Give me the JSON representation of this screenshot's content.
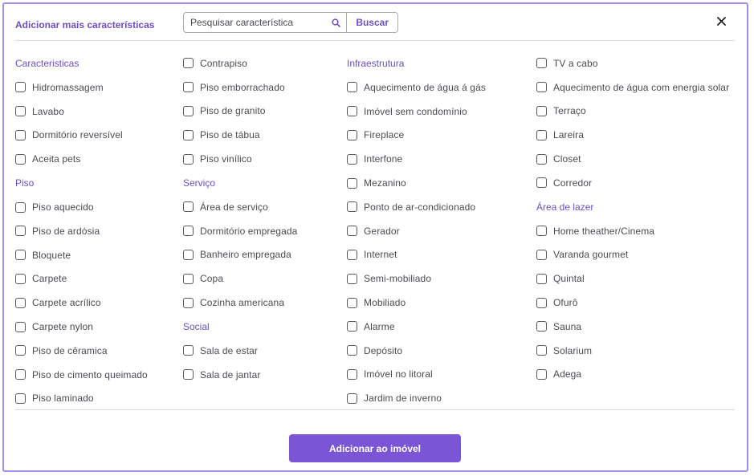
{
  "header": {
    "title": "Adicionar mais características",
    "search_placeholder": "Pesquisar característica",
    "search_button": "Buscar",
    "close_symbol": "✕"
  },
  "icons": {
    "search": "search-icon",
    "close": "close-icon"
  },
  "colors": {
    "accent": "#7a56d6",
    "heading": "#6d4ec4",
    "frame": "#a38bea"
  },
  "columns": [
    [
      {
        "type": "heading",
        "label": "Caracteristicas"
      },
      {
        "type": "option",
        "label": "Hidromassagem"
      },
      {
        "type": "option",
        "label": "Lavabo"
      },
      {
        "type": "option",
        "label": "Dormitório reversível"
      },
      {
        "type": "option",
        "label": "Aceita pets"
      },
      {
        "type": "heading",
        "label": "Piso"
      },
      {
        "type": "option",
        "label": "Piso aquecido"
      },
      {
        "type": "option",
        "label": "Piso de ardósia"
      },
      {
        "type": "option",
        "label": "Bloquete"
      },
      {
        "type": "option",
        "label": "Carpete"
      },
      {
        "type": "option",
        "label": "Carpete acrílico"
      },
      {
        "type": "option",
        "label": "Carpete nylon"
      },
      {
        "type": "option",
        "label": "Piso de cêramica"
      },
      {
        "type": "option",
        "label": "Piso de cimento queimado"
      },
      {
        "type": "option",
        "label": "Piso laminado"
      }
    ],
    [
      {
        "type": "option",
        "label": "Contrapiso"
      },
      {
        "type": "option",
        "label": "Piso emborrachado"
      },
      {
        "type": "option",
        "label": "Piso de granito"
      },
      {
        "type": "option",
        "label": "Piso de tábua"
      },
      {
        "type": "option",
        "label": "Piso vinílico"
      },
      {
        "type": "heading",
        "label": "Serviço"
      },
      {
        "type": "option",
        "label": "Área de serviço"
      },
      {
        "type": "option",
        "label": "Dormitório empregada"
      },
      {
        "type": "option",
        "label": "Banheiro empregada"
      },
      {
        "type": "option",
        "label": "Copa"
      },
      {
        "type": "option",
        "label": "Cozinha  americana"
      },
      {
        "type": "heading",
        "label": "Social"
      },
      {
        "type": "option",
        "label": "Sala de estar"
      },
      {
        "type": "option",
        "label": "Sala de jantar"
      }
    ],
    [
      {
        "type": "heading",
        "label": "Infraestrutura"
      },
      {
        "type": "option",
        "label": "Aquecimento de água á gás"
      },
      {
        "type": "option",
        "label": "Imóvel sem condomínio"
      },
      {
        "type": "option",
        "label": "Fireplace"
      },
      {
        "type": "option",
        "label": "Interfone"
      },
      {
        "type": "option",
        "label": "Mezanino"
      },
      {
        "type": "option",
        "label": "Ponto de ar-condicionado"
      },
      {
        "type": "option",
        "label": "Gerador"
      },
      {
        "type": "option",
        "label": "Internet"
      },
      {
        "type": "option",
        "label": "Semi-mobiliado"
      },
      {
        "type": "option",
        "label": "Mobiliado"
      },
      {
        "type": "option",
        "label": "Alarme"
      },
      {
        "type": "option",
        "label": "Depósito"
      },
      {
        "type": "option",
        "label": "Imóvel no litoral"
      },
      {
        "type": "option",
        "label": "Jardim de inverno"
      }
    ],
    [
      {
        "type": "option",
        "label": "TV a cabo"
      },
      {
        "type": "option",
        "label": "Aquecimento de água com energia solar"
      },
      {
        "type": "option",
        "label": "Terraço"
      },
      {
        "type": "option",
        "label": "Lareira"
      },
      {
        "type": "option",
        "label": "Closet"
      },
      {
        "type": "option",
        "label": "Corredor"
      },
      {
        "type": "heading",
        "label": "Área de lazer"
      },
      {
        "type": "option",
        "label": "Home theather/Cinema"
      },
      {
        "type": "option",
        "label": "Varanda gourmet"
      },
      {
        "type": "option",
        "label": "Quintal"
      },
      {
        "type": "option",
        "label": "Ofurô"
      },
      {
        "type": "option",
        "label": "Sauna"
      },
      {
        "type": "option",
        "label": "Solarium"
      },
      {
        "type": "option",
        "label": "Adega"
      }
    ]
  ],
  "footer": {
    "submit_label": "Adicionar ao imóvel"
  }
}
